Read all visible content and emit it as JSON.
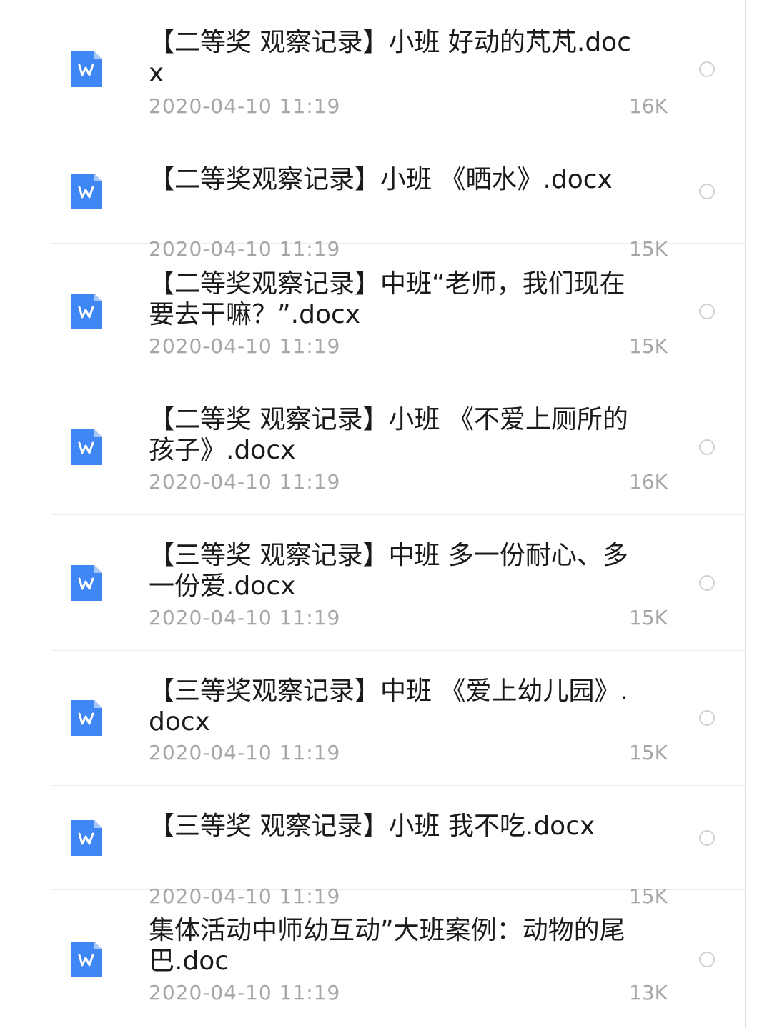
{
  "colors": {
    "word_icon": "#3f87f5",
    "word_icon_fold": "#a8c8fa",
    "text_primary": "#1a1a1a",
    "text_secondary": "#a6a6a6",
    "divider": "#ececec"
  },
  "files": [
    {
      "name": "【二等奖 观察记录】小班 好动的芃芃.docx",
      "date": "2020-04-10 11:19",
      "size": "16K",
      "icon": "word-doc-icon"
    },
    {
      "name": "【二等奖观察记录】小班 《晒水》.docx",
      "date": "2020-04-10 11:19",
      "size": "15K",
      "icon": "word-doc-icon"
    },
    {
      "name": "【二等奖观察记录】中班“老师，我们现在要去干嘛？”.docx",
      "date": "2020-04-10 11:19",
      "size": "15K",
      "icon": "word-doc-icon"
    },
    {
      "name": "【二等奖 观察记录】小班 《不爱上厕所的孩子》.docx",
      "date": "2020-04-10 11:19",
      "size": "16K",
      "icon": "word-doc-icon"
    },
    {
      "name": "【三等奖 观察记录】中班 多一份耐心、多一份爱.docx",
      "date": "2020-04-10 11:19",
      "size": "15K",
      "icon": "word-doc-icon"
    },
    {
      "name": "【三等奖观察记录】中班 《爱上幼儿园》.docx",
      "date": "2020-04-10 11:19",
      "size": "15K",
      "icon": "word-doc-icon"
    },
    {
      "name": "【三等奖 观察记录】小班 我不吃.docx",
      "date": "2020-04-10 11:19",
      "size": "15K",
      "icon": "word-doc-icon"
    },
    {
      "name": "集体活动中师幼互动”大班案例：动物的尾巴.doc",
      "date": "2020-04-10 11:19",
      "size": "13K",
      "icon": "word-doc-icon"
    }
  ]
}
